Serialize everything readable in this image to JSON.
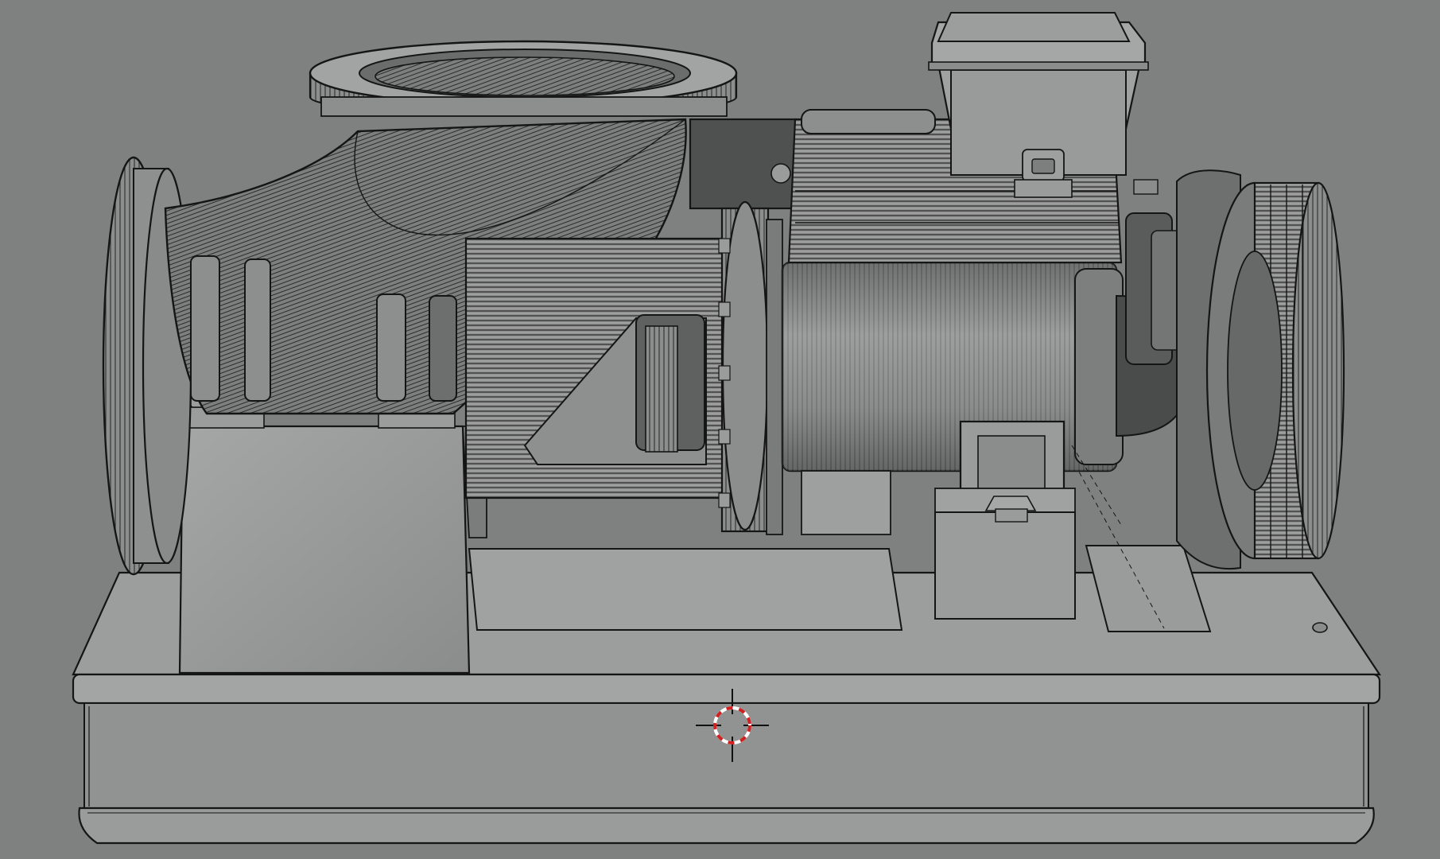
{
  "viewport": {
    "background": "#7f8080",
    "shading": "hidden-line-grayscale",
    "cursor_icon": "3d-cursor-icon"
  },
  "colors": {
    "ink": "#151515",
    "metal_light": "#a4a5a5",
    "metal_mid": "#8f9090",
    "metal_dark": "#5c5d5d",
    "cursor_ring_a": "#d21f1f",
    "cursor_ring_b": "#ffffff"
  },
  "model": {
    "parts": [
      "baseplate",
      "inlet-flange",
      "elbow-pipe",
      "outlet-flange",
      "pump-casing",
      "pump-support-block",
      "shaft-housing",
      "motor-body",
      "motor-fins",
      "junction-box",
      "rear-support",
      "coupling",
      "pulley-wheel"
    ]
  }
}
